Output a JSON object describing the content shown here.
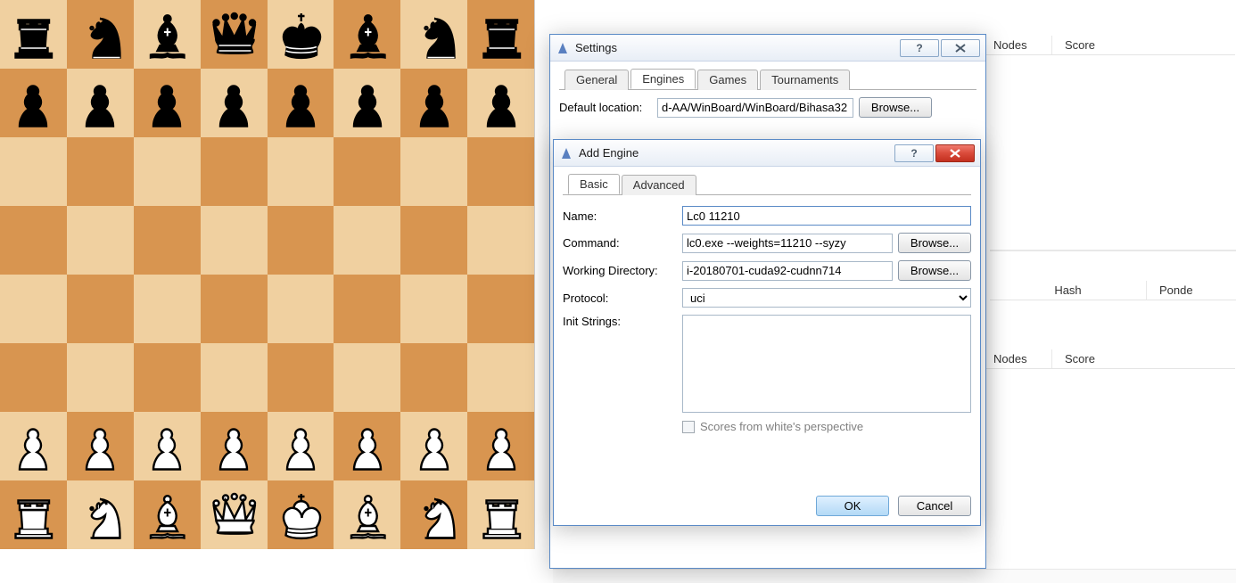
{
  "bg": {
    "headers1": {
      "nodes": "Nodes",
      "score": "Score"
    },
    "headers2": {
      "hash": "Hash",
      "ponder": "Ponde"
    },
    "headers3": {
      "nodes": "Nodes",
      "score": "Score"
    }
  },
  "board": {
    "rows": [
      [
        "br",
        "bn",
        "bb",
        "bq",
        "bk",
        "bb",
        "bn",
        "br"
      ],
      [
        "bp",
        "bp",
        "bp",
        "bp",
        "bp",
        "bp",
        "bp",
        "bp"
      ],
      [
        "",
        "",
        "",
        "",
        "",
        "",
        "",
        ""
      ],
      [
        "",
        "",
        "",
        "",
        "",
        "",
        "",
        ""
      ],
      [
        "",
        "",
        "",
        "",
        "",
        "",
        "",
        ""
      ],
      [
        "",
        "",
        "",
        "",
        "",
        "",
        "",
        ""
      ],
      [
        "wp",
        "wp",
        "wp",
        "wp",
        "wp",
        "wp",
        "wp",
        "wp"
      ],
      [
        "wr",
        "wn",
        "wb",
        "wq",
        "wk",
        "wb",
        "wn",
        "wr"
      ]
    ]
  },
  "settings": {
    "title": "Settings",
    "tabs": {
      "general": "General",
      "engines": "Engines",
      "games": "Games",
      "tournaments": "Tournaments"
    },
    "default_location_label": "Default location:",
    "default_location_value": "d-AA/WinBoard/WinBoard/Bihasa32",
    "browse": "Browse..."
  },
  "addengine": {
    "title": "Add Engine",
    "tabs": {
      "basic": "Basic",
      "advanced": "Advanced"
    },
    "name_label": "Name:",
    "name_value": "Lc0 11210",
    "command_label": "Command:",
    "command_value": "lc0.exe --weights=11210 --syzy",
    "workdir_label": "Working Directory:",
    "workdir_value": "i-20180701-cuda92-cudnn714",
    "protocol_label": "Protocol:",
    "protocol_value": "uci",
    "init_label": "Init Strings:",
    "init_value": "",
    "scores_white_label": "Scores from white's perspective",
    "browse": "Browse...",
    "ok": "OK",
    "cancel": "Cancel"
  }
}
